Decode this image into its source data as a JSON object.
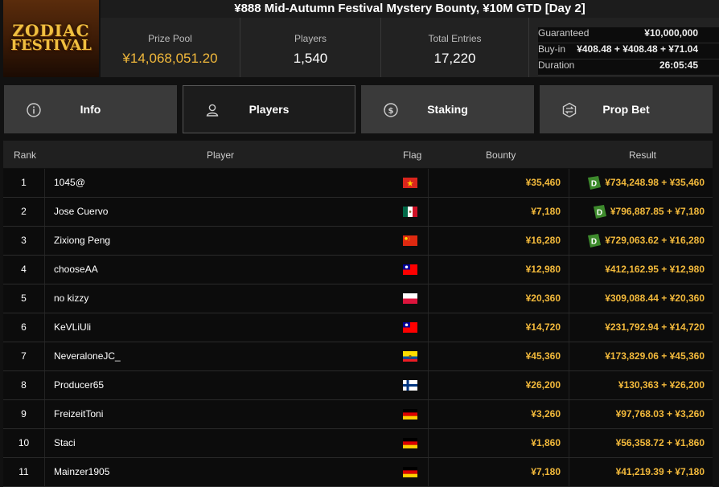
{
  "title": "¥888 Mid-Autumn Festival Mystery Bounty, ¥10M GTD [Day 2]",
  "logo": {
    "line1": "ZODIAC",
    "line2": "FESTIVAL"
  },
  "stats": {
    "prize_pool": {
      "label": "Prize Pool",
      "value": "¥14,068,051.20"
    },
    "players": {
      "label": "Players",
      "value": "1,540"
    },
    "total_entries": {
      "label": "Total Entries",
      "value": "17,220"
    },
    "guaranteed": {
      "label": "Guaranteed",
      "value": "¥10,000,000"
    },
    "buyin": {
      "label": "Buy-in",
      "value": "¥408.48 + ¥408.48 + ¥71.04"
    },
    "duration": {
      "label": "Duration",
      "value": "26:05:45"
    }
  },
  "tabs": [
    {
      "label": "Info",
      "icon": "info-icon"
    },
    {
      "label": "Players",
      "icon": "user-icon",
      "active": true
    },
    {
      "label": "Staking",
      "icon": "staking-icon"
    },
    {
      "label": "Prop Bet",
      "icon": "prop-bet-icon"
    }
  ],
  "table": {
    "headers": {
      "rank": "Rank",
      "player": "Player",
      "flag": "Flag",
      "bounty": "Bounty",
      "result": "Result"
    },
    "rows": [
      {
        "rank": "1",
        "player": "1045@",
        "flag": "vietnam",
        "bounty": "¥35,460",
        "result": "¥734,248.98 + ¥35,460",
        "badge": true
      },
      {
        "rank": "2",
        "player": "Jose Cuervo",
        "flag": "mexico",
        "bounty": "¥7,180",
        "result": "¥796,887.85 + ¥7,180",
        "badge": true
      },
      {
        "rank": "3",
        "player": "Zixiong Peng",
        "flag": "china",
        "bounty": "¥16,280",
        "result": "¥729,063.62 + ¥16,280",
        "badge": true
      },
      {
        "rank": "4",
        "player": "chooseAA",
        "flag": "taiwan",
        "bounty": "¥12,980",
        "result": "¥412,162.95 + ¥12,980",
        "badge": false
      },
      {
        "rank": "5",
        "player": "no kizzy",
        "flag": "poland",
        "bounty": "¥20,360",
        "result": "¥309,088.44 + ¥20,360",
        "badge": false
      },
      {
        "rank": "6",
        "player": "KeVLiUli",
        "flag": "taiwan",
        "bounty": "¥14,720",
        "result": "¥231,792.94 + ¥14,720",
        "badge": false
      },
      {
        "rank": "7",
        "player": "NeveraloneJC_",
        "flag": "ecuador",
        "bounty": "¥45,360",
        "result": "¥173,829.06 + ¥45,360",
        "badge": false
      },
      {
        "rank": "8",
        "player": "Producer65",
        "flag": "finland",
        "bounty": "¥26,200",
        "result": "¥130,363 + ¥26,200",
        "badge": false
      },
      {
        "rank": "9",
        "player": "FreizeitToni",
        "flag": "germany",
        "bounty": "¥3,260",
        "result": "¥97,768.03 + ¥3,260",
        "badge": false
      },
      {
        "rank": "10",
        "player": "Staci",
        "flag": "germany",
        "bounty": "¥1,860",
        "result": "¥56,358.72 + ¥1,860",
        "badge": false
      },
      {
        "rank": "11",
        "player": "Mainzer1905",
        "flag": "germany",
        "bounty": "¥7,180",
        "result": "¥41,219.39 + ¥7,180",
        "badge": false
      }
    ]
  },
  "colors": {
    "accent_gold": "#f2b93b",
    "background": "#111111",
    "badge_green": "#3d8a2c"
  }
}
